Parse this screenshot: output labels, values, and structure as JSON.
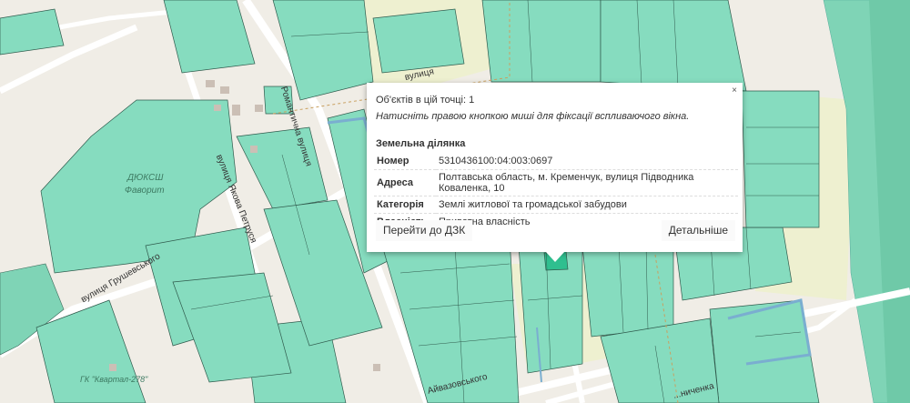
{
  "popup": {
    "close_label": "×",
    "objects_count": "Об'єктів в цій точці: 1",
    "hint": "Натисніть правою кнопкою миші для фіксації вспливаючого вікна.",
    "section_title": "Земельна ділянка",
    "rows": [
      {
        "key": "Номер",
        "value": "5310436100:04:003:0697"
      },
      {
        "key": "Адреса",
        "value": "Полтавська область, м. Кременчук, вулиця Підводника Коваленка, 10"
      },
      {
        "key": "Категорія",
        "value": "Землі житлової та громадської забудови"
      },
      {
        "key": "Власність",
        "value": "Приватна власність"
      }
    ],
    "goto_button": "Перейти до ДЗК",
    "details_button": "Детальніше"
  },
  "map_labels": {
    "street_romantychna": "Романтична вулиця",
    "street_top": "вулиця",
    "street_petrusia": "вулиця Якова Петруся",
    "street_hrushevskoho": "вулиця Грушевського",
    "street_aivazovskoho": "Айвазовського",
    "street_bottom_right": "...ниченка",
    "sports_school": "ДЮКСШ",
    "sports_school_sub": "Фаворит",
    "garage_coop": "ГК \"Квартал-278\""
  },
  "colors": {
    "parcel": "#86dcbf",
    "background": "#f0ede6",
    "selected": "#2fbf8f"
  }
}
